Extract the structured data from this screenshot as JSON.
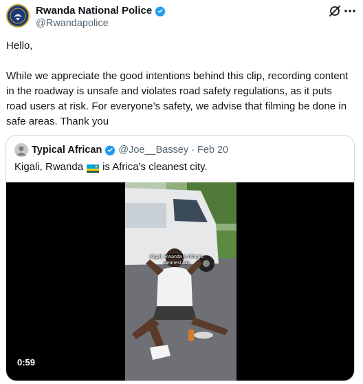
{
  "author": {
    "display_name": "Rwanda National Police",
    "handle": "@Rwandapolice",
    "avatar_icon": "police-badge-icon",
    "verified_icon": "verified-badge-icon"
  },
  "actions": {
    "grok_icon": "grok-icon",
    "more_icon": "more-options-icon"
  },
  "tweet": {
    "greeting": "Hello,",
    "body": "While we appreciate the good intentions behind this clip, recording content in the roadway is unsafe and violates road safety regulations, as it puts road users at risk. For everyone’s safety, we advise that filming be done in safe areas. Thank you"
  },
  "quoted": {
    "display_name": "Typical African",
    "handle": "@Joe__Bassey",
    "separator": "·",
    "date": "Feb 20",
    "text_before_flag": "Kigali, Rwanda",
    "flag_icon": "rwanda-flag-icon",
    "text_after_flag": "is Africa's cleanest city.",
    "video": {
      "caption": "Kigali, Rwanda is Africa's cleanest city",
      "duration": "0:59"
    }
  },
  "colors": {
    "text": "#0f1419",
    "secondary": "#536471",
    "verified": "#1d9bf0",
    "border": "#cfd9de"
  }
}
